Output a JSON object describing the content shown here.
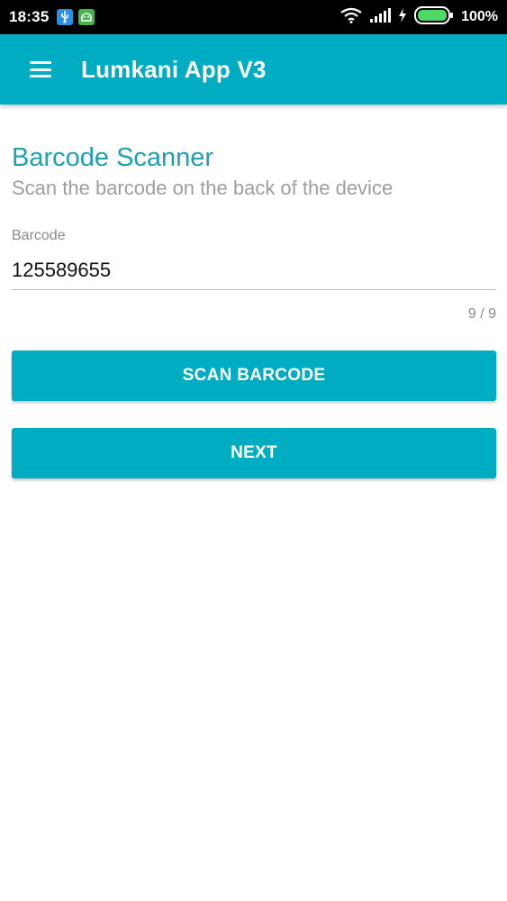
{
  "status_bar": {
    "time": "18:35",
    "battery_percent": "100%",
    "icons": [
      "usb-notification-icon",
      "android-notification-icon",
      "wifi-icon",
      "signal-icon",
      "charging-icon",
      "battery-icon"
    ]
  },
  "app_bar": {
    "title": "Lumkani App V3",
    "menu_icon": "hamburger-menu-icon",
    "color": "#00ACC1"
  },
  "scanner": {
    "title": "Barcode Scanner",
    "subtitle": "Scan the barcode on the back of the device",
    "field_label": "Barcode",
    "field_value": "125589655",
    "char_counter": "9 / 9"
  },
  "buttons": {
    "scan_label": "SCAN BARCODE",
    "next_label": "NEXT"
  },
  "colors": {
    "accent": "#00ACC1",
    "title_text": "#1FA0B3"
  }
}
